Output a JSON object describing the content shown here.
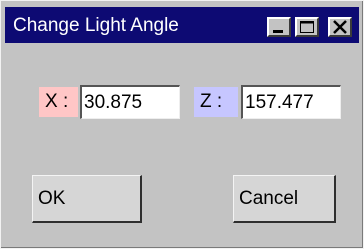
{
  "window": {
    "title": "Change Light Angle",
    "controls": {
      "minimize_icon": "minimize-icon",
      "maximize_icon": "maximize-icon",
      "close_icon": "close-icon"
    }
  },
  "fields": {
    "x": {
      "label": "X :",
      "value": "30.875",
      "color": "#ffc6c6"
    },
    "z": {
      "label": "Z :",
      "value": "157.477",
      "color": "#c6c6ff"
    }
  },
  "buttons": {
    "ok": "OK",
    "cancel": "Cancel"
  },
  "colors": {
    "titlebar": "#0d0a73",
    "window_bg": "#c3c3c3"
  }
}
